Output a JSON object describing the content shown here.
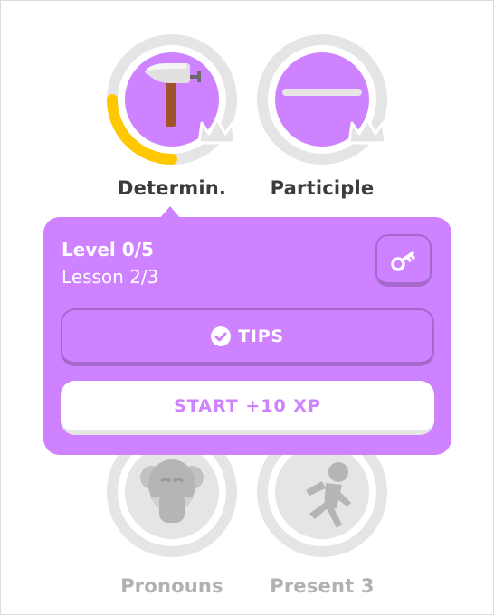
{
  "skills": {
    "determiners": {
      "label": "Determin.",
      "icon": "hammer-icon",
      "progress": 0.25,
      "state": "active"
    },
    "participle": {
      "label": "Participle",
      "icon": "dash-icon",
      "progress": 0,
      "state": "active"
    },
    "pronouns": {
      "label": "Pronouns",
      "icon": "elder-face-icon",
      "state": "locked"
    },
    "present3": {
      "label": "Present 3",
      "icon": "runner-icon",
      "state": "locked"
    }
  },
  "popup": {
    "level": "Level 0/5",
    "lesson": "Lesson 2/3",
    "key_icon": "key-icon",
    "tips_label": "TIPS",
    "start_label": "START +10 XP"
  },
  "colors": {
    "accent": "#ce82ff",
    "accent_dark": "#a568cc",
    "progress_gold": "#ffc800",
    "ring_gray": "#e5e5e5",
    "locked_gray": "#b1b1b1"
  }
}
